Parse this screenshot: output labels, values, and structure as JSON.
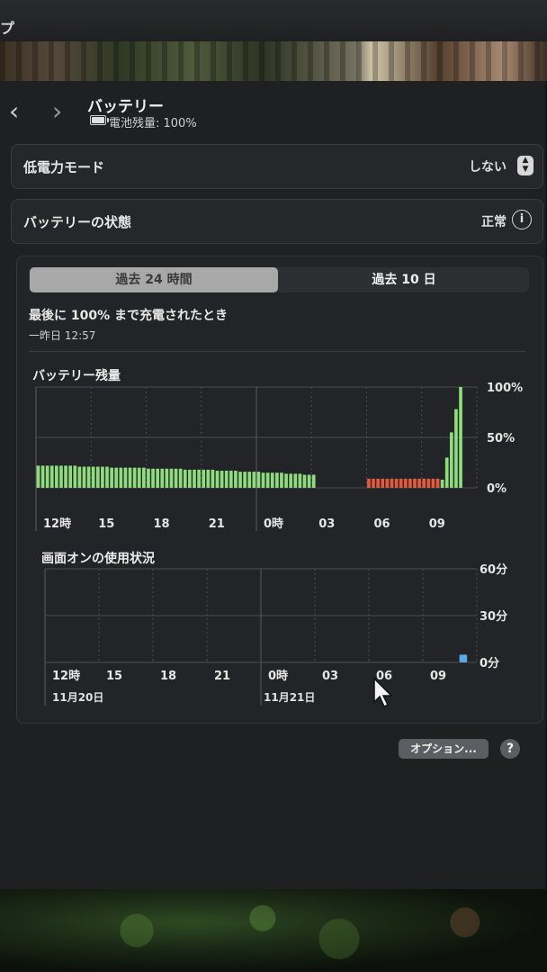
{
  "window": {
    "title_fragment": "プ"
  },
  "header": {
    "title": "バッテリー",
    "battery_level": "電池残量: 100%",
    "back_icon": "chevron-left-icon",
    "forward_icon": "chevron-right-icon"
  },
  "low_power": {
    "label": "低電力モード",
    "value": "しない"
  },
  "battery_health": {
    "label": "バッテリーの状態",
    "value": "正常"
  },
  "tabs": [
    {
      "label": "過去 24 時間",
      "selected": true
    },
    {
      "label": "過去 10 日",
      "selected": false
    }
  ],
  "last_charged": {
    "label": "最後に 100% まで充電されたとき",
    "date": "一昨日 12:57"
  },
  "colors": {
    "battery_green": "#8fdc7e",
    "battery_red": "#e35a3c",
    "usage_blue": "#5aa9e6"
  },
  "chart_data": [
    {
      "type": "bar",
      "title": "バッテリー残量",
      "ylim": [
        0,
        100
      ],
      "y_tick_labels": [
        "100%",
        "50%",
        "0%"
      ],
      "y_tick_values": [
        100,
        50,
        0
      ],
      "x_tick_labels": [
        "12時",
        "15",
        "18",
        "21",
        "0時",
        "03",
        "06",
        "09"
      ],
      "grid": true,
      "series": [
        {
          "color_role": "green",
          "start_hour": 12.0,
          "slot_hours": 0.25,
          "values": [
            22,
            22,
            22,
            22,
            22,
            22,
            22,
            22,
            22,
            21,
            21,
            21,
            21,
            21,
            21,
            21,
            20,
            20,
            20,
            20,
            20,
            20,
            20,
            20,
            19,
            19,
            19,
            19,
            19,
            19,
            19,
            19,
            18,
            18,
            18,
            18,
            18,
            18,
            18,
            17,
            17,
            17,
            17,
            17,
            16,
            16,
            16,
            16,
            16,
            15,
            15,
            15,
            15,
            15,
            14,
            14,
            14,
            14,
            13,
            13,
            13
          ]
        },
        {
          "color_role": "red",
          "start_hour": 30.0,
          "slot_hours": 0.25,
          "values": [
            9,
            9,
            9,
            9,
            9,
            9,
            9,
            9,
            9,
            9,
            9,
            9,
            9,
            9,
            9,
            9
          ]
        },
        {
          "color_role": "green",
          "start_hour": 34.0,
          "slot_hours": 0.25,
          "values": [
            8,
            30,
            55,
            78,
            100
          ]
        }
      ]
    },
    {
      "type": "bar",
      "title": "画面オンの使用状況",
      "ylim": [
        0,
        60
      ],
      "y_tick_labels": [
        "60分",
        "30分",
        "0分"
      ],
      "y_tick_values": [
        60,
        30,
        0
      ],
      "x_tick_labels": [
        "12時",
        "15",
        "18",
        "21",
        "0時",
        "03",
        "06",
        "09"
      ],
      "date_labels": [
        "11月20日",
        "11月21日"
      ],
      "grid": true,
      "series": [
        {
          "color_role": "blue",
          "start_hour": 35.0,
          "slot_hours": 0.5,
          "values": [
            5
          ]
        }
      ]
    }
  ],
  "footer": {
    "options_label": "オプション...",
    "help_label": "?"
  }
}
